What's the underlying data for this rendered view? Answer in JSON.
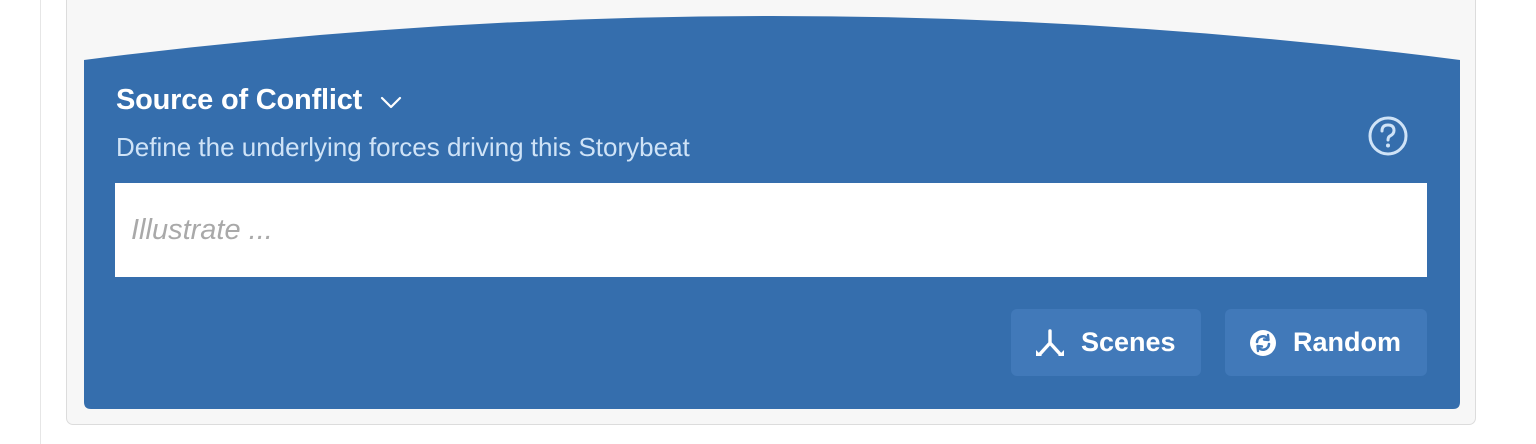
{
  "section": {
    "title": "Source of Conflict",
    "subtitle": "Define the underlying forces driving this Storybeat",
    "chevron_icon": "chevron-down-icon",
    "help_icon": "question-circle-icon"
  },
  "input": {
    "placeholder": "Illustrate ...",
    "value": ""
  },
  "buttons": {
    "scenes": {
      "label": "Scenes",
      "icon": "merge-branch-icon"
    },
    "random": {
      "label": "Random",
      "icon": "refresh-circle-icon"
    }
  },
  "colors": {
    "panel": "#356ead",
    "button": "#4179b9",
    "subtitle": "#cfe3f7",
    "card": "#f7f7f7"
  }
}
